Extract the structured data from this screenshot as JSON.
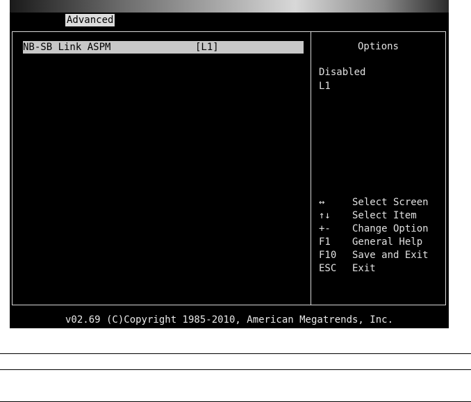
{
  "tabs": {
    "active": "Advanced"
  },
  "setting": {
    "name": "NB-SB Link ASPM",
    "value": "[L1]"
  },
  "options": {
    "title": "Options",
    "items": [
      "Disabled",
      "L1"
    ]
  },
  "help": [
    {
      "key": "↔",
      "text": "Select Screen"
    },
    {
      "key": "↑↓",
      "text": "Select Item"
    },
    {
      "key": "+-",
      "text": "Change Option"
    },
    {
      "key": "F1",
      "text": "General Help"
    },
    {
      "key": "F10",
      "text": "Save and Exit"
    },
    {
      "key": "ESC",
      "text": "Exit"
    }
  ],
  "footer": "v02.69 (C)Copyright 1985-2010, American Megatrends, Inc."
}
